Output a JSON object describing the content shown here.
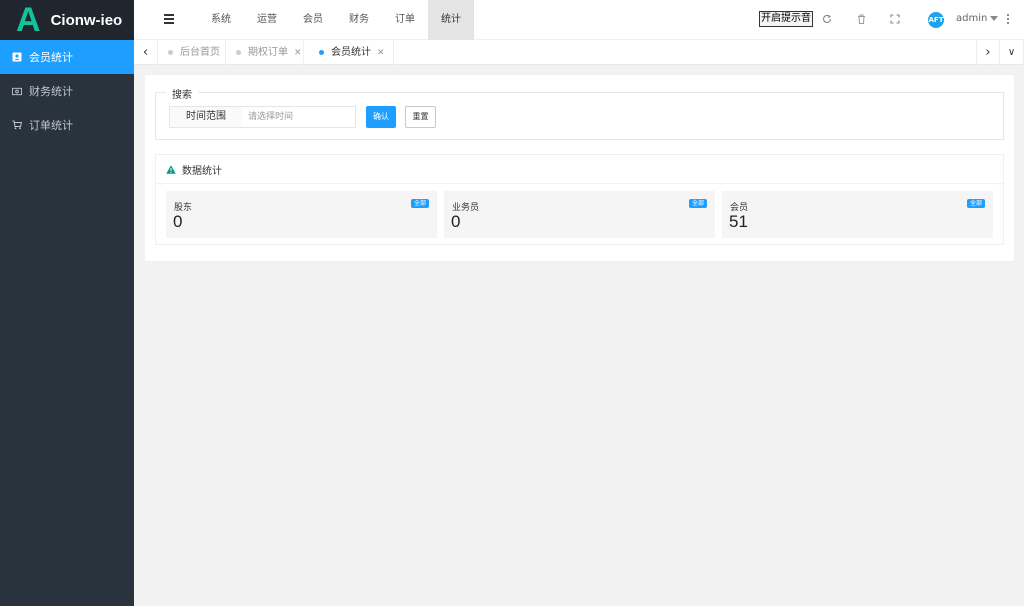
{
  "brand": {
    "letter": "A",
    "name": "Cionw-ieo",
    "accent": "#15c39a"
  },
  "sidebar": {
    "items": [
      {
        "label": "会员统计",
        "icon": "user-card-icon",
        "active": true
      },
      {
        "label": "财务统计",
        "icon": "money-icon",
        "active": false
      },
      {
        "label": "订单统计",
        "icon": "cart-icon",
        "active": false
      }
    ]
  },
  "header": {
    "nav": [
      {
        "label": "系统",
        "active": false
      },
      {
        "label": "运营",
        "active": false
      },
      {
        "label": "会员",
        "active": false
      },
      {
        "label": "财务",
        "active": false
      },
      {
        "label": "订单",
        "active": false
      },
      {
        "label": "统计",
        "active": true
      }
    ],
    "remind_button": "开启提示音",
    "avatar_text": "AFT",
    "user": "admin"
  },
  "tabs": [
    {
      "label": "后台首页",
      "closable": false,
      "active": false
    },
    {
      "label": "期权订单",
      "closable": true,
      "active": false
    },
    {
      "label": "会员统计",
      "closable": true,
      "active": true
    }
  ],
  "search": {
    "legend": "搜索",
    "range_label": "时间范围",
    "date_placeholder": "请选择时间",
    "confirm_label": "确认",
    "reset_label": "重置"
  },
  "stats": {
    "title": "数据统计",
    "cards": [
      {
        "title": "股东",
        "value": "0",
        "badge": "全部"
      },
      {
        "title": "业务员",
        "value": "0",
        "badge": "全部"
      },
      {
        "title": "会员",
        "value": "51",
        "badge": "全部"
      }
    ]
  },
  "colors": {
    "primary": "#1e9fff",
    "sidebar_bg": "#28333e"
  }
}
